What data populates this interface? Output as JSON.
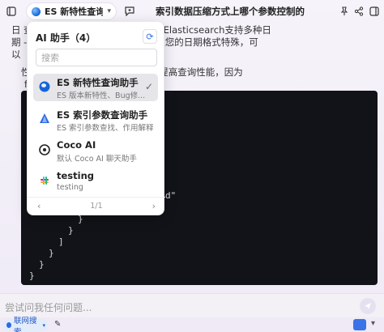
{
  "header": {
    "assistant_selector": "ES 新特性查询...",
    "title": "索引数据压缩方式上哪个参数控制的"
  },
  "chat": {
    "line1": "日              查询中的格式一致。默认情况下，Elasticsearch支持多种日",
    "line2": "期              -dd'T'HH:mm:ss.SSSZ 等。如果您的日期格式特殊，可",
    "line3": "以",
    "line4": "性              ：使用 filter 而不是 query 来提高查询性能，因为",
    "line5": "f",
    "code": [
      "d\"",
      "}",
      "}",
      "]",
      "}",
      "}",
      "}"
    ]
  },
  "panel": {
    "title": "AI 助手（4）",
    "search_placeholder": "搜索",
    "items": [
      {
        "name": "ES 新特性查询助手",
        "desc": "ES 版本新特性、Bug修...",
        "icon": "globe-icon",
        "active": true
      },
      {
        "name": "ES 索引参数查询助手",
        "desc": "ES 索引参数查找、作用解释。",
        "icon": "sail-icon",
        "active": false
      },
      {
        "name": "Coco AI",
        "desc": "默认 Coco AI 聊天助手",
        "icon": "coco-icon",
        "active": false
      },
      {
        "name": "testing",
        "desc": "testing",
        "icon": "slack-icon",
        "active": false
      }
    ],
    "pager": "1/1"
  },
  "input": {
    "placeholder": "尝试问我任何问题..."
  },
  "footer": {
    "web_search": "联网搜索"
  },
  "colors": {
    "accent": "#3b72e8",
    "code_bg": "#111318",
    "active_item": "#e6e6ea"
  }
}
